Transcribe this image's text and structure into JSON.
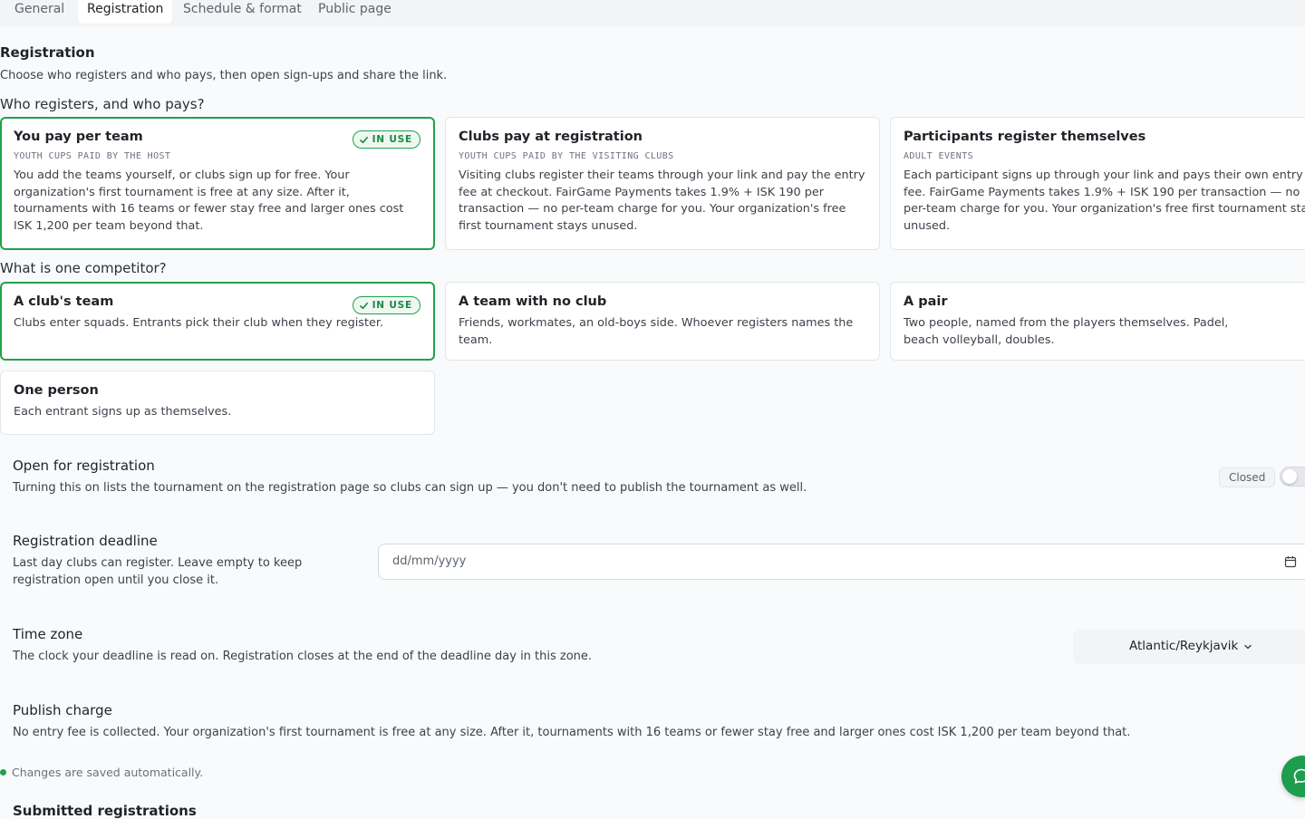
{
  "tabs": [
    {
      "label": "General"
    },
    {
      "label": "Registration"
    },
    {
      "label": "Schedule & format"
    },
    {
      "label": "Public page"
    }
  ],
  "section": {
    "title": "Registration",
    "subtitle": "Choose who registers and who pays, then open sign-ups and share the link."
  },
  "who_pays": {
    "question": "Who registers, and who pays?",
    "options": [
      {
        "title": "You pay per team",
        "badge": "IN USE",
        "tag": "YOUTH CUPS PAID BY THE HOST",
        "body": "You add the teams yourself, or clubs sign up for free. Your organization's first tournament is free at any size. After it, tournaments with 16 teams or fewer stay free and larger ones cost ISK 1,200 per team beyond that."
      },
      {
        "title": "Clubs pay at registration",
        "tag": "YOUTH CUPS PAID BY THE VISITING CLUBS",
        "body": "Visiting clubs register their teams through your link and pay the entry fee at checkout. FairGame Payments takes 1.9% + ISK 190 per transaction — no per-team charge for you. Your organization's free first tournament stays unused."
      },
      {
        "title": "Participants register themselves",
        "tag": "ADULT EVENTS",
        "body_lines": [
          "Each participant signs up through your link and pays their own entry",
          "fee. FairGame Payments takes 1.9% + ISK 190 per transaction — no",
          "per-team charge for you. Your organization's free first tournament stays",
          "unused."
        ]
      }
    ]
  },
  "competitor": {
    "question": "What is one competitor?",
    "options": [
      {
        "title": "A club's team",
        "badge": "IN USE",
        "body": "Clubs enter squads. Entrants pick their club when they register."
      },
      {
        "title": "A team with no club",
        "body": "Friends, workmates, an old-boys side. Whoever registers names the team."
      },
      {
        "title": "A pair",
        "body": "Two people, named from the players themselves. Padel, beach volleyball, doubles."
      },
      {
        "title": "One person",
        "body": "Each entrant signs up as themselves."
      }
    ]
  },
  "open_registration": {
    "title": "Open for registration",
    "description": "Turning this on lists the tournament on the registration page so clubs can sign up — you don't need to publish the tournament as well.",
    "status": "Closed",
    "enabled": false
  },
  "deadline": {
    "title": "Registration deadline",
    "description_lines": [
      "Last day clubs can register. Leave empty to keep",
      "registration open until you close it."
    ],
    "placeholder": "dd/mm/yyyy",
    "value": ""
  },
  "timezone": {
    "title": "Time zone",
    "description": "The clock your deadline is read on. Registration closes at the end of the deadline day in this zone.",
    "value": "Atlantic/Reykjavik"
  },
  "publish_charge": {
    "title": "Publish charge",
    "description": "No entry fee is collected. Your organization's first tournament is free at any size. After it, tournaments with 16 teams or fewer stay free and larger ones cost ISK 1,200 per team beyond that."
  },
  "autosave": {
    "text": "Changes are saved automatically."
  },
  "submitted": {
    "title": "Submitted registrations"
  },
  "colors": {
    "accent": "#22a04b",
    "background": "#f9fafb"
  },
  "icons": {
    "badge": "check-icon",
    "date": "calendar-icon",
    "select": "chevron-down-icon",
    "fab": "chat-bubble-icon"
  }
}
